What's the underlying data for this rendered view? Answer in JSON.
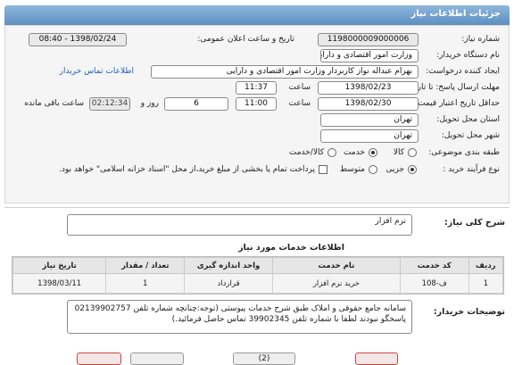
{
  "page": {
    "title": "جزئیات اطلاعات نیاز"
  },
  "form": {
    "need_number_label": "شماره نیاز:",
    "need_number": "1198000009000006",
    "announce_label": "تاریخ و ساعت اعلان عمومی:",
    "announce_value": "1398/02/24 - 08:40",
    "buyer_label": "نام دستگاه خریدار:",
    "buyer_value": "وزارت امور اقتصادی و دارایی",
    "creator_label": "ایجاد کننده درخواست:",
    "creator_value": "بهرام عبداله نواز کاربردار وزارت امور اقتصادی و دارایی",
    "contact_link": "اطلاعات تماس خریدار",
    "reply_deadline_label": "مهلت ارسال پاسخ: تا تاریخ:",
    "reply_date": "1398/02/23",
    "time_label_1": "ساعت",
    "reply_time": "11:37",
    "validity_label": "حداقل تاریخ اعتبار قیمت: تا تاریخ:",
    "validity_date": "1398/02/30",
    "time_label_2": "ساعت",
    "validity_time": "11:00",
    "days_value": "6",
    "days_label": "روز و",
    "remaining_value": "02:12:34",
    "remaining_label": "ساعت باقی مانده",
    "province_label": "استان محل تحویل:",
    "province_value": "تهران",
    "city_label": "شهر محل تحویل:",
    "city_value": "تهران",
    "category_label": "طبقه بندی موضوعی:",
    "category_options": [
      "کالا",
      "خدمت",
      "کالا/خدمت"
    ],
    "process_label": "نوع فرآیند خرید :",
    "process_options": [
      "جزیی",
      "متوسط"
    ],
    "payment_note": "پرداخت تمام یا بخشی از مبلغ خرید،از محل \"اسناد خزانه اسلامی\" خواهد بود."
  },
  "general_desc": {
    "label": "شرح کلی نیاز:",
    "value": "نرم افزار"
  },
  "services": {
    "title": "اطلاعات خدمات مورد نیاز",
    "headers": [
      "ردیف",
      "کد خدمت",
      "نام خدمت",
      "واحد اندازه گیری",
      "تعداد / مقدار",
      "تاریخ نیاز"
    ],
    "rows": [
      [
        "1",
        "ف-108",
        "خرید نرم افزار",
        "قرارداد",
        "1",
        "1398/03/11"
      ]
    ]
  },
  "notes": {
    "label": "توضیحات خریدار:",
    "value": "سامانه جامع حقوقی و املاک طبق شرح خدمات پیوستی (توجه:چنانچه شماره تلفن 02139902757 پاسخگو نبودند لطفا با شماره تلفن 39902345 تماس حاصل فرمائید.)"
  },
  "buttons": {
    "b1": "(2)"
  },
  "colors": {
    "title_bar": "#5c8fc0",
    "link": "#1f5fbf"
  }
}
